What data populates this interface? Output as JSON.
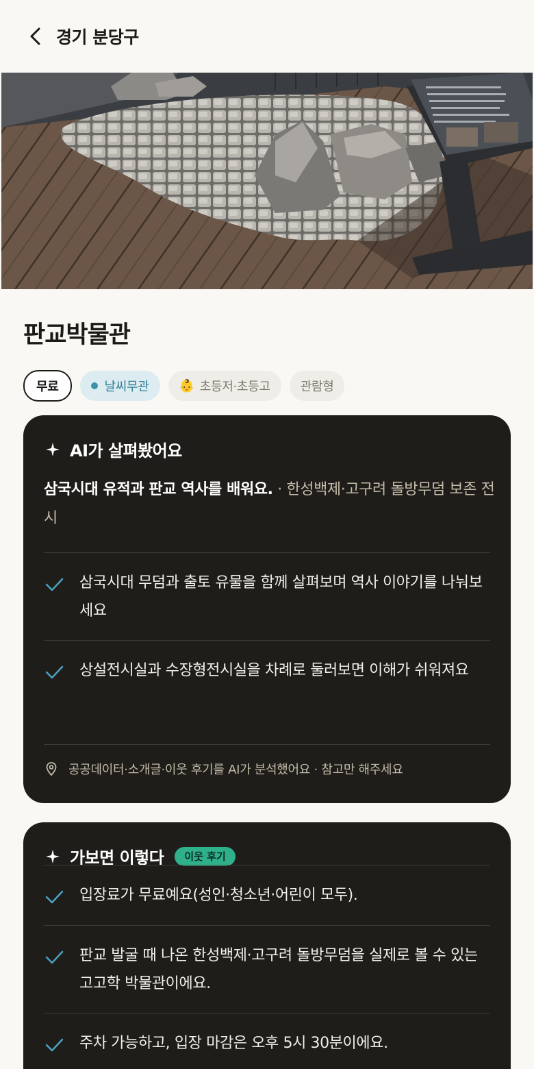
{
  "header": {
    "title": "경기 분당구",
    "back_icon": "chevron-left-icon"
  },
  "place": {
    "title": "판교박물관"
  },
  "chips": {
    "free": "무료",
    "weather": "날씨무관",
    "age": "초등저·초등고",
    "age_icon": "baby-face-emoji",
    "type": "관람형"
  },
  "ai_card": {
    "title": "AI가 살펴봤어요",
    "summary_main": "삼국시대 유적과 판교 역사를 배워요.",
    "summary_sub": " · 한성백제·고구려 돌방무덤 보존 전시",
    "items": [
      "삼국시대 무덤과 출토 유물을 함께 살펴보며 역사 이야기를 나눠보세요",
      "상설전시실과 수장형전시실을 차례로 둘러보면 이해가 쉬워져요"
    ],
    "footnote": "공공데이터·소개글·이웃 후기를 AI가 분석했어요 · 참고만 해주세요"
  },
  "review_card": {
    "title": "가보면 이렇다",
    "badge": "이웃 후기",
    "items": [
      "입장료가 무료예요(성인·청소년·어린이 모두).",
      "판교 발굴 때 나온 한성백제·고구려 돌방무덤을 실제로 볼 수 있는 고고학 박물관이에요.",
      "주차 가능하고, 입장 마감은 오후 5시 30분이에요."
    ]
  },
  "colors": {
    "background": "#f9f8f5",
    "card": "#1f1d1a",
    "check": "#4aa3c1",
    "badge": "#2fb08a",
    "weather_chip": "#dcecf1"
  }
}
